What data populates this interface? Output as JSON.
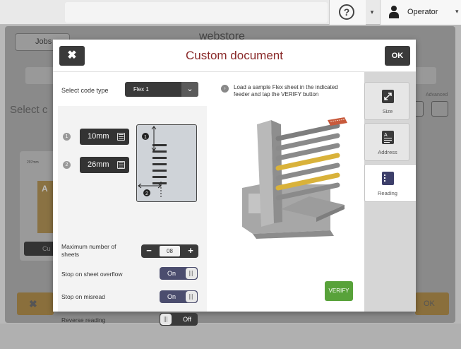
{
  "topbar": {
    "help_icon": "question-mark-circle-icon",
    "user_label": "Operator",
    "user_icon": "person-icon"
  },
  "background": {
    "jobs_label": "Jobs",
    "brand": "webstore",
    "select_label": "Select c",
    "advanced_label": "Advanced",
    "card_dims": "297mm",
    "card_code": "Flex 1",
    "card_button": "Cu",
    "ok_label": "OK"
  },
  "dialog": {
    "title": "Custom document",
    "close_glyph": "✖",
    "ok_label": "OK",
    "code_type_label": "Select code type",
    "code_type_value": "Flex 1",
    "measure1": {
      "number": "1",
      "value": "10mm"
    },
    "measure2": {
      "number": "2",
      "value": "26mm"
    },
    "max_sheets_label": "Maximum number of sheets",
    "max_sheets_value": "08",
    "stepper_minus": "−",
    "stepper_plus": "+",
    "overflow_label": "Stop on sheet overflow",
    "overflow_state": "On",
    "misread_label": "Stop on misread",
    "misread_state": "On",
    "reverse_label": "Reverse reading",
    "reverse_state": "Off",
    "instruction": "Load a sample Flex sheet in the indicated feeder and tap the VERIFY button",
    "verify_label": "VERIFY"
  },
  "tabs": [
    {
      "label": "Size",
      "icon": "resize-arrows-icon",
      "active": false
    },
    {
      "label": "Address",
      "icon": "address-document-icon",
      "active": false
    },
    {
      "label": "Reading",
      "icon": "barcode-document-icon",
      "active": true
    }
  ],
  "colors": {
    "title": "#8a2a2a",
    "toggle_on": "#4b4d6e",
    "verify": "#58a23a",
    "highlight_tray": "#d9b23a",
    "reading_icon": "#3d3f6a"
  }
}
